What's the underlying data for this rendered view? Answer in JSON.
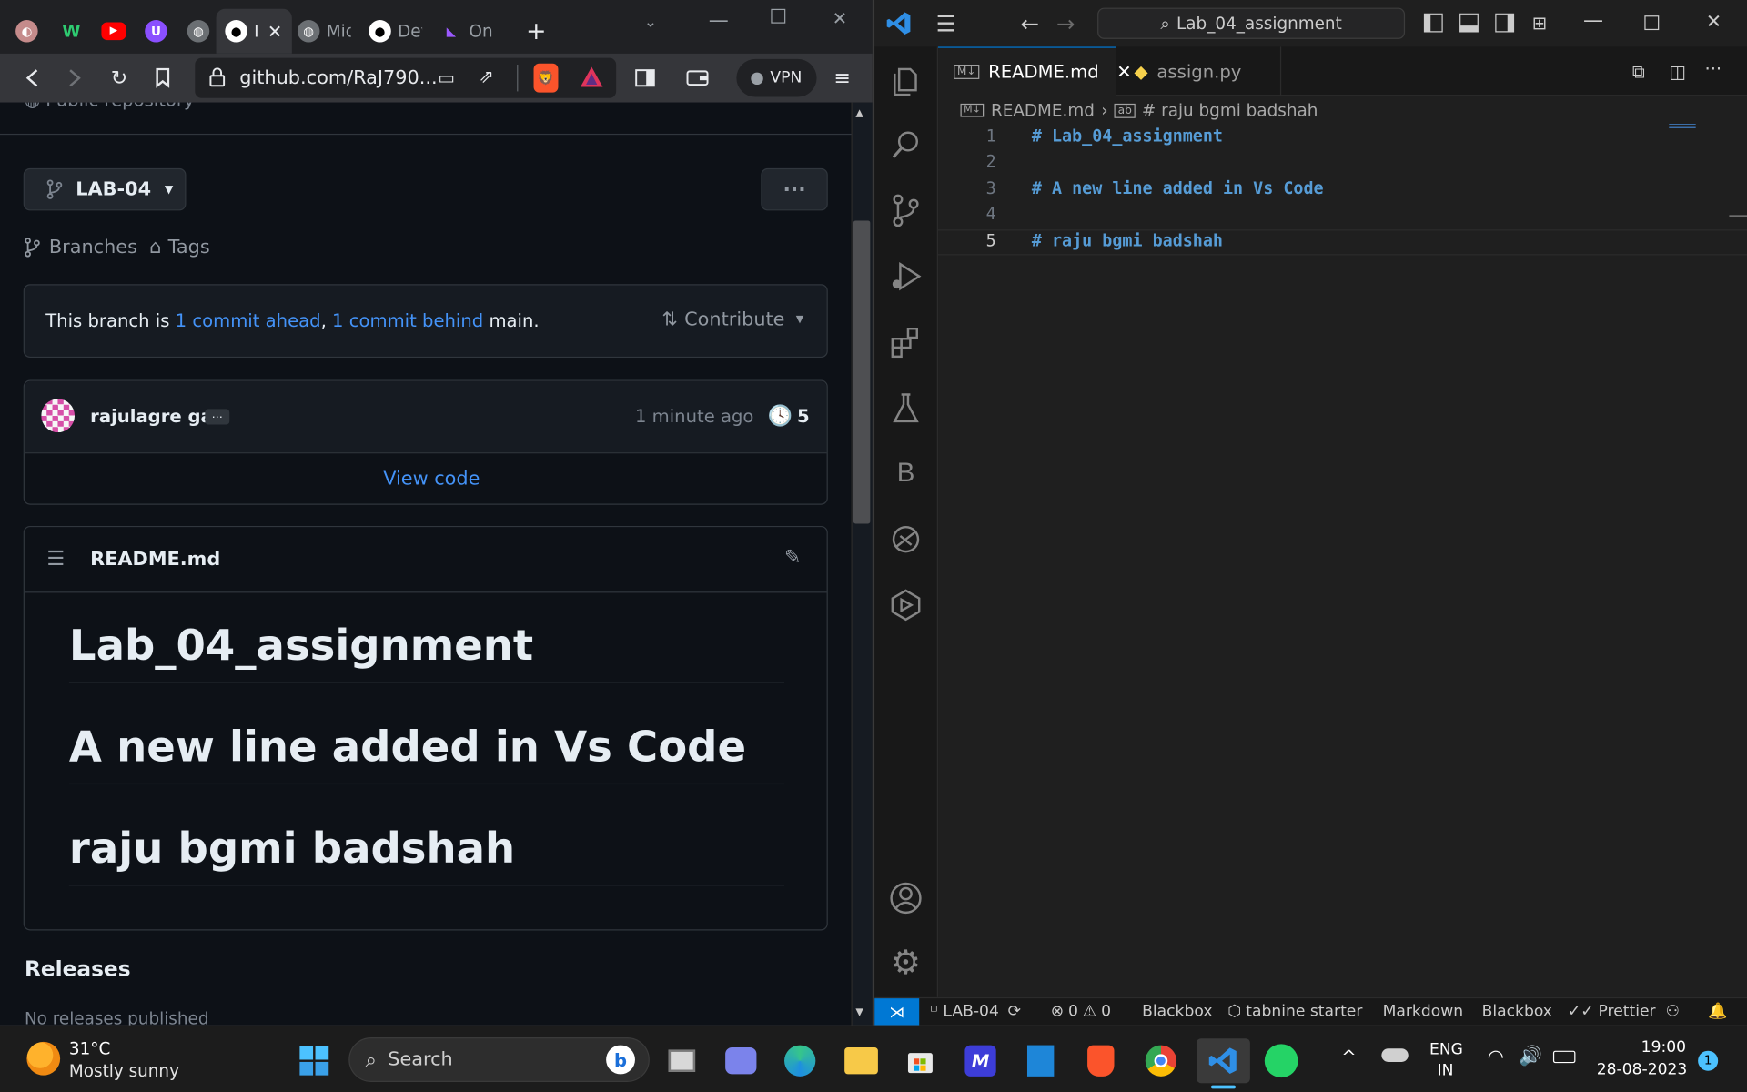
{
  "browser": {
    "tabs": [
      {
        "icon": "profile-icon",
        "label": ""
      },
      {
        "icon": "wire-icon",
        "label": ""
      },
      {
        "icon": "youtube-icon",
        "label": ""
      },
      {
        "icon": "proton-icon",
        "label": ""
      },
      {
        "icon": "globe-icon",
        "label": ""
      },
      {
        "icon": "github-icon",
        "label": "I",
        "active": true
      },
      {
        "icon": "globe-icon",
        "label": "Mic"
      },
      {
        "icon": "github-icon",
        "label": "Dev"
      },
      {
        "icon": "onlinegdb-icon",
        "label": "Onl"
      }
    ],
    "url": "github.com/RaJ790...",
    "vpn_label": "VPN",
    "colors": {
      "tabstrip": "#202124",
      "toolbar": "#35363a",
      "brave": "#fb542b"
    }
  },
  "github": {
    "visibility_partial": "Public repository",
    "branch": "LAB-04",
    "branches_label": "Branches",
    "tags_label": "Tags",
    "branch_status": {
      "prefix": "This branch is ",
      "ahead": "1 commit ahead",
      "sep": ", ",
      "behind": "1 commit behind",
      "suffix": " main."
    },
    "contribute_label": "Contribute",
    "commit": {
      "author": "rajulagre ga",
      "ellipsis": "…",
      "time": "1 minute ago",
      "count": "5"
    },
    "view_code": "View code",
    "readme": {
      "filename": "README.md",
      "headings": [
        "Lab_04_assignment",
        "A new line added in Vs Code",
        "raju bgmi badshah"
      ]
    },
    "releases": {
      "title": "Releases",
      "empty": "No releases published"
    }
  },
  "vscode": {
    "search_text": "Lab_04_assignment",
    "tabs": [
      {
        "label": "README.md",
        "icon": "markdown-icon",
        "active": true
      },
      {
        "label": "assign.py",
        "icon": "python-icon",
        "active": false
      }
    ],
    "breadcrumb": {
      "file": "README.md",
      "symbol": "# raju bgmi badshah"
    },
    "lines": [
      {
        "n": "1",
        "code": "# Lab_04_assignment"
      },
      {
        "n": "2",
        "code": ""
      },
      {
        "n": "3",
        "code": "# A new line added in Vs Code"
      },
      {
        "n": "4",
        "code": ""
      },
      {
        "n": "5",
        "code": "# raju bgmi badshah"
      }
    ],
    "active_line": "5",
    "activity_letter": "B",
    "status": {
      "branch": "LAB-04",
      "errors": "0",
      "warnings": "0",
      "blackbox1": "Blackbox",
      "tabnine": "tabnine starter",
      "language": "Markdown",
      "blackbox2": "Blackbox",
      "prettier": "Prettier"
    }
  },
  "taskbar": {
    "weather": {
      "temp": "31°C",
      "desc": "Mostly sunny"
    },
    "search_placeholder": "Search",
    "lang": {
      "line1": "ENG",
      "line2": "IN"
    },
    "clock": {
      "time": "19:00",
      "date": "28-08-2023"
    },
    "notifications": "1"
  }
}
